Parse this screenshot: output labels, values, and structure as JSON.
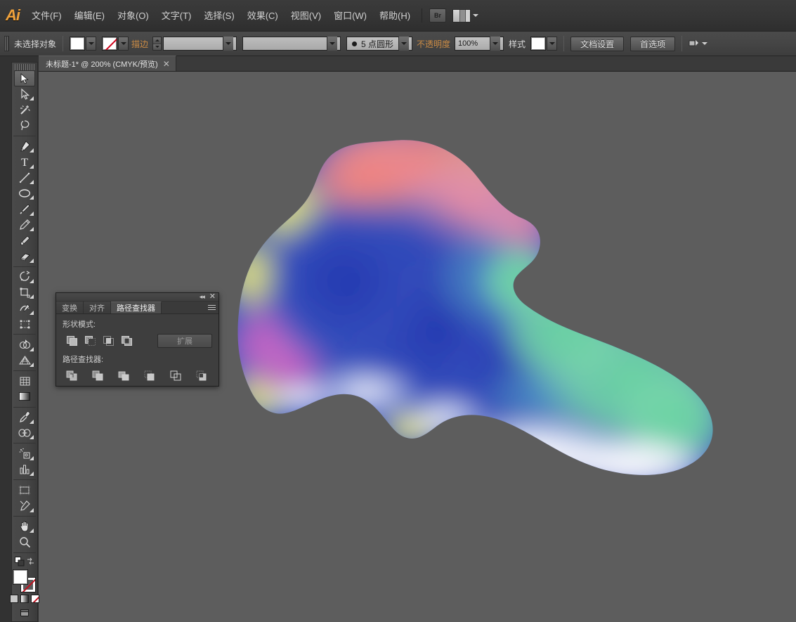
{
  "app": {
    "name": "Adobe Illustrator",
    "logo_text": "Ai"
  },
  "menubar": {
    "items": [
      {
        "label": "文件(F)",
        "name": "menu-file"
      },
      {
        "label": "编辑(E)",
        "name": "menu-edit"
      },
      {
        "label": "对象(O)",
        "name": "menu-object"
      },
      {
        "label": "文字(T)",
        "name": "menu-type"
      },
      {
        "label": "选择(S)",
        "name": "menu-select"
      },
      {
        "label": "效果(C)",
        "name": "menu-effect"
      },
      {
        "label": "视图(V)",
        "name": "menu-view"
      },
      {
        "label": "窗口(W)",
        "name": "menu-window"
      },
      {
        "label": "帮助(H)",
        "name": "menu-help"
      }
    ],
    "bridge_label": "Br",
    "workspace_icon": "workspace-switcher-icon"
  },
  "optionsbar": {
    "selection_status": "未选择对象",
    "fill_swatch_color": "#ffffff",
    "stroke_swatch": "none",
    "stroke_label": "描边",
    "stroke_weight_value": "",
    "stroke_weight_placeholder": "",
    "brush_definition_value": "",
    "brush_style_value": "5 点圆形",
    "opacity_label": "不透明度",
    "opacity_value": "100%",
    "style_label": "样式",
    "document_setup_label": "文档设置",
    "preferences_label": "首选项"
  },
  "tabbar": {
    "document_title": "未标题-1* @ 200% (CMYK/预览)",
    "close_glyph": "✕"
  },
  "toolbar": {
    "tools": [
      {
        "name": "selection-tool",
        "label": "选择工具",
        "active": true,
        "flyout": false
      },
      {
        "name": "direct-selection-tool",
        "label": "直接选择工具",
        "active": false,
        "flyout": true
      },
      {
        "name": "magic-wand-tool",
        "label": "魔棒工具",
        "active": false,
        "flyout": false
      },
      {
        "name": "lasso-tool",
        "label": "套索工具",
        "active": false,
        "flyout": false
      },
      {
        "name": "pen-tool",
        "label": "钢笔工具",
        "active": false,
        "flyout": true
      },
      {
        "name": "type-tool",
        "label": "文字工具",
        "active": false,
        "flyout": true
      },
      {
        "name": "line-segment-tool",
        "label": "直线段工具",
        "active": false,
        "flyout": true
      },
      {
        "name": "ellipse-tool",
        "label": "椭圆工具",
        "active": false,
        "flyout": true
      },
      {
        "name": "paintbrush-tool",
        "label": "画笔工具",
        "active": false,
        "flyout": true
      },
      {
        "name": "pencil-tool",
        "label": "铅笔工具",
        "active": false,
        "flyout": true
      },
      {
        "name": "blob-brush-tool",
        "label": "斑点画笔工具",
        "active": false,
        "flyout": false
      },
      {
        "name": "eraser-tool",
        "label": "橡皮擦工具",
        "active": false,
        "flyout": true
      },
      {
        "name": "rotate-tool",
        "label": "旋转工具",
        "active": false,
        "flyout": true
      },
      {
        "name": "scale-tool",
        "label": "比例缩放工具",
        "active": false,
        "flyout": true
      },
      {
        "name": "width-warp-tool",
        "label": "宽度工具",
        "active": false,
        "flyout": true
      },
      {
        "name": "free-transform-tool",
        "label": "自由变换工具",
        "active": false,
        "flyout": false
      },
      {
        "name": "shape-builder-tool",
        "label": "形状生成器工具",
        "active": false,
        "flyout": true
      },
      {
        "name": "perspective-grid-tool",
        "label": "透视网格工具",
        "active": false,
        "flyout": true
      },
      {
        "name": "mesh-tool",
        "label": "网格工具",
        "active": false,
        "flyout": false
      },
      {
        "name": "gradient-tool",
        "label": "渐变工具",
        "active": false,
        "flyout": false
      },
      {
        "name": "eyedropper-tool",
        "label": "吸管工具",
        "active": false,
        "flyout": true
      },
      {
        "name": "blend-tool",
        "label": "混合工具",
        "active": false,
        "flyout": true
      },
      {
        "name": "symbol-sprayer-tool",
        "label": "符号喷枪工具",
        "active": false,
        "flyout": true
      },
      {
        "name": "column-graph-tool",
        "label": "柱形图工具",
        "active": false,
        "flyout": true
      },
      {
        "name": "artboard-tool",
        "label": "画板工具",
        "active": false,
        "flyout": false
      },
      {
        "name": "slice-tool",
        "label": "切片工具",
        "active": false,
        "flyout": true
      },
      {
        "name": "hand-tool",
        "label": "抓手工具",
        "active": false,
        "flyout": true
      },
      {
        "name": "zoom-tool",
        "label": "缩放工具",
        "active": false,
        "flyout": false
      }
    ],
    "fill_color": "#ffffff",
    "stroke_color": "none",
    "swap_icon": "swap-fill-stroke-icon",
    "default_icon": "default-fill-stroke-icon",
    "color_mode_icons": [
      "color-icon",
      "gradient-icon",
      "none-icon"
    ],
    "screen_mode_icon": "screen-mode-icon"
  },
  "pathfinder_panel": {
    "tabs": [
      {
        "label": "变换",
        "name": "panel-tab-transform",
        "active": false
      },
      {
        "label": "对齐",
        "name": "panel-tab-align",
        "active": false
      },
      {
        "label": "路径查找器",
        "name": "panel-tab-pathfinder",
        "active": true
      }
    ],
    "collapse_glyph": "◂◂",
    "close_glyph": "✕",
    "shape_modes_label": "形状模式:",
    "shape_mode_buttons": [
      {
        "name": "unite-button",
        "label": "联集"
      },
      {
        "name": "minus-front-button",
        "label": "减去顶层"
      },
      {
        "name": "intersect-button",
        "label": "交集"
      },
      {
        "name": "exclude-button",
        "label": "差集"
      }
    ],
    "expand_label": "扩展",
    "pathfinders_label": "路径查找器:",
    "pathfinder_buttons": [
      {
        "name": "divide-button",
        "label": "分割"
      },
      {
        "name": "trim-button",
        "label": "修边"
      },
      {
        "name": "merge-button",
        "label": "合并"
      },
      {
        "name": "crop-button",
        "label": "裁剪"
      },
      {
        "name": "outline-button",
        "label": "轮廓"
      },
      {
        "name": "minus-back-button",
        "label": "减去后方对象"
      }
    ]
  },
  "canvas": {
    "background_color": "#5d5d5d",
    "artwork_name": "gradient-mesh-blob",
    "artwork_colors": {
      "top_pink": "#f28a84",
      "upper_rose": "#e98a9e",
      "left_yellow": "#e4e07a",
      "magenta": "#c濃",
      "center_blue": "#2f49b5",
      "right_green": "#6ed1a0",
      "bottom_white": "#ffffff",
      "violet": "#b96fc0"
    }
  }
}
